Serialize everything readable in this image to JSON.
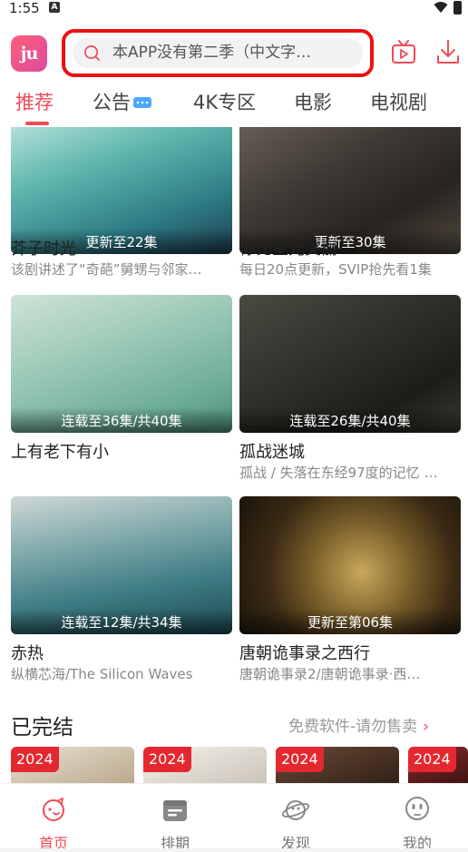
{
  "status": {
    "time": "1:55",
    "notif_letter": "A"
  },
  "app": {
    "logo_text": "ju"
  },
  "search": {
    "placeholder": "本APP没有第二季（中文字…"
  },
  "tabs": [
    {
      "label": "推荐",
      "active": true
    },
    {
      "label": "公告",
      "active": false
    },
    {
      "label": "4K专区",
      "active": false
    },
    {
      "label": "电影",
      "active": false
    },
    {
      "label": "电视剧",
      "active": false
    }
  ],
  "cards": [
    {
      "title": "芥子时光",
      "subtitle": "该剧讲述了“奇葩”舅甥与邻家…",
      "badge": "更新至22集"
    },
    {
      "title": "你比星光美丽",
      "subtitle": "每日20点更新，SVIP抢先看1集",
      "badge": "更新至30集"
    },
    {
      "title": "上有老下有小",
      "subtitle": "",
      "badge": "连载至36集/共40集"
    },
    {
      "title": "孤战迷城",
      "subtitle": "孤战 / 失落在东经97度的记忆 …",
      "badge": "连载至26集/共40集"
    },
    {
      "title": "赤热",
      "subtitle": "纵横芯海/The Silicon Waves",
      "badge": "连载至12集/共34集"
    },
    {
      "title": "唐朝诡事录之西行",
      "subtitle": "唐朝诡事录2/唐朝诡事录·西…",
      "badge": "更新至第06集"
    }
  ],
  "section": {
    "title": "已完结",
    "more": "免费软件-请勿售卖"
  },
  "thumbs": [
    {
      "year": "2024"
    },
    {
      "year": "2024"
    },
    {
      "year": "2024"
    },
    {
      "year": "2024"
    }
  ],
  "nav": [
    {
      "label": "首页",
      "icon": "home-icon",
      "active": true
    },
    {
      "label": "排期",
      "icon": "calendar-icon",
      "active": false
    },
    {
      "label": "发现",
      "icon": "discover-icon",
      "active": false
    },
    {
      "label": "我的",
      "icon": "profile-icon",
      "active": false
    }
  ],
  "colors": {
    "accent": "#f04a58",
    "search_highlight": "#ee1111",
    "badge_red": "#e5272f"
  }
}
